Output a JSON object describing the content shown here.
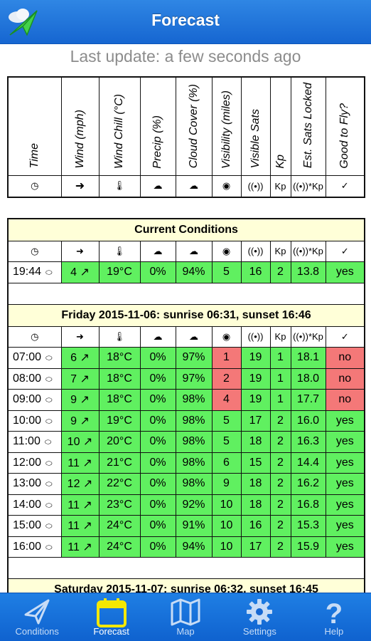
{
  "header": {
    "title": "Forecast"
  },
  "last_update": "Last update: a few seconds ago",
  "legend": {
    "columns": [
      "Time",
      "Wind (mph)",
      "Wind Chill (°C)",
      "Precip (%)",
      "Cloud Cover (%)",
      "Visibility (miles)",
      "Visible Sats",
      "Kp",
      "Est. Sats Locked",
      "Good to Fly?"
    ],
    "icons": [
      "clock-icon",
      "arrow-right-icon",
      "thermometer-icon",
      "rain-cloud-icon",
      "cloud-icon",
      "eye-icon",
      "satellite-icon",
      "Kp",
      "satellite-kp-icon",
      "check-circle-icon"
    ],
    "kp_label": "Kp",
    "sats_kp_label": "Kp"
  },
  "current": {
    "title": "Current Conditions",
    "row": {
      "time": "19:44",
      "wind": "4",
      "chill": "19°C",
      "precip": "0%",
      "cloud": "94%",
      "vis": "5",
      "sats": "16",
      "kp": "2",
      "locked": "13.8",
      "fly": "yes"
    }
  },
  "day1": {
    "title": "Friday 2015-11-06: sunrise 06:31, sunset 16:46",
    "rows": [
      {
        "time": "07:00",
        "wind": "6",
        "chill": "18°C",
        "precip": "0%",
        "cloud": "97%",
        "vis": "1",
        "sats": "19",
        "kp": "1",
        "locked": "18.1",
        "fly": "no"
      },
      {
        "time": "08:00",
        "wind": "7",
        "chill": "18°C",
        "precip": "0%",
        "cloud": "97%",
        "vis": "2",
        "sats": "19",
        "kp": "1",
        "locked": "18.0",
        "fly": "no"
      },
      {
        "time": "09:00",
        "wind": "9",
        "chill": "18°C",
        "precip": "0%",
        "cloud": "98%",
        "vis": "4",
        "sats": "19",
        "kp": "1",
        "locked": "17.7",
        "fly": "no"
      },
      {
        "time": "10:00",
        "wind": "9",
        "chill": "19°C",
        "precip": "0%",
        "cloud": "98%",
        "vis": "5",
        "sats": "17",
        "kp": "2",
        "locked": "16.0",
        "fly": "yes"
      },
      {
        "time": "11:00",
        "wind": "10",
        "chill": "20°C",
        "precip": "0%",
        "cloud": "98%",
        "vis": "5",
        "sats": "18",
        "kp": "2",
        "locked": "16.3",
        "fly": "yes"
      },
      {
        "time": "12:00",
        "wind": "11",
        "chill": "21°C",
        "precip": "0%",
        "cloud": "98%",
        "vis": "6",
        "sats": "15",
        "kp": "2",
        "locked": "14.4",
        "fly": "yes"
      },
      {
        "time": "13:00",
        "wind": "12",
        "chill": "22°C",
        "precip": "0%",
        "cloud": "98%",
        "vis": "9",
        "sats": "18",
        "kp": "2",
        "locked": "16.2",
        "fly": "yes"
      },
      {
        "time": "14:00",
        "wind": "11",
        "chill": "23°C",
        "precip": "0%",
        "cloud": "92%",
        "vis": "10",
        "sats": "18",
        "kp": "2",
        "locked": "16.8",
        "fly": "yes"
      },
      {
        "time": "15:00",
        "wind": "11",
        "chill": "24°C",
        "precip": "0%",
        "cloud": "91%",
        "vis": "10",
        "sats": "16",
        "kp": "2",
        "locked": "15.3",
        "fly": "yes"
      },
      {
        "time": "16:00",
        "wind": "11",
        "chill": "24°C",
        "precip": "0%",
        "cloud": "94%",
        "vis": "10",
        "sats": "17",
        "kp": "2",
        "locked": "15.9",
        "fly": "yes"
      }
    ]
  },
  "day2": {
    "title": "Saturday 2015-11-07: sunrise 06:32, sunset 16:45"
  },
  "tabs": {
    "conditions": "Conditions",
    "forecast": "Forecast",
    "map": "Map",
    "settings": "Settings",
    "help": "Help"
  },
  "colors": {
    "header_blue": "#1e74dc",
    "good_green": "#60f060",
    "bad_red": "#f47878",
    "section_yellow": "#ffffd8"
  }
}
